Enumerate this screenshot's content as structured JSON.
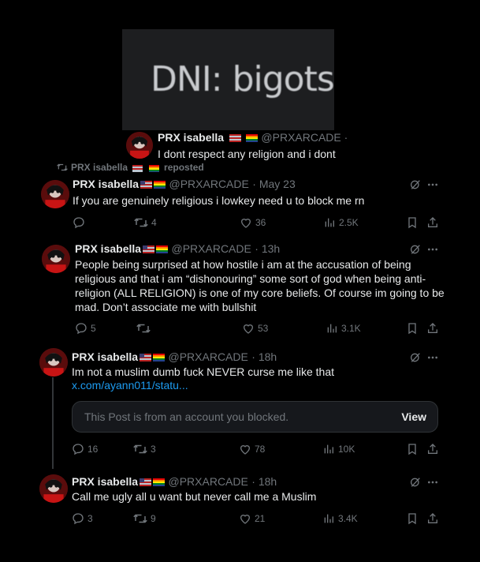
{
  "banner": {
    "text": "DNI: bigots. '"
  },
  "quoted_preview": {
    "name": "PRX isabella",
    "handle": "@PRXARCADE ·",
    "text": "I dont respect any religion and i dont"
  },
  "repost_banner": {
    "label": "PRX isabella",
    "suffix": "reposted"
  },
  "tweets": [
    {
      "name": "PRX isabella",
      "handle": "@PRXARCADE",
      "date": "· May 23",
      "text": "If you are genuinely religious i lowkey need u to block me rn",
      "replies": "",
      "retweets": "4",
      "likes": "36",
      "views": "2.5K"
    },
    {
      "name": "PRX isabella",
      "handle": "@PRXARCADE",
      "date": "· 13h",
      "lines": [
        "People being surprised at how hostile i am at the accusation of being",
        "religious and that i am “dishonouring” some sort of god when being anti-",
        "religion (ALL RELIGION) is one of my core beliefs. Of course im going to be",
        "mad. Don’t associate me with bullshit"
      ],
      "replies": "5",
      "retweets": "",
      "likes": "53",
      "views": "3.1K"
    },
    {
      "name": "PRX isabella",
      "handle": "@PRXARCADE",
      "date": "· 18h",
      "text": "Im not a muslim dumb fuck NEVER curse me like that",
      "link": "x.com/ayann011/statu...",
      "blocked_text": "This Post is from an account you blocked.",
      "view_label": "View",
      "replies": "16",
      "retweets": "3",
      "likes": "78",
      "views": "10K"
    },
    {
      "name": "PRX isabella",
      "handle": "@PRXARCADE",
      "date": "· 18h",
      "text": "Call me ugly all u want but never call me a Muslim",
      "replies": "3",
      "retweets": "9",
      "likes": "21",
      "views": "3.4K"
    }
  ],
  "icons": {
    "reply": "reply-icon",
    "retweet": "retweet-icon",
    "like": "heart-icon",
    "views": "views-icon",
    "bookmark": "bookmark-icon",
    "share": "share-icon",
    "grok": "grok-icon",
    "more": "more-icon",
    "flags": "flag-emoji-icons"
  },
  "colors": {
    "background": "#000000",
    "text": "#e7e9ea",
    "muted": "#71767b",
    "link": "#1d9bf0"
  }
}
